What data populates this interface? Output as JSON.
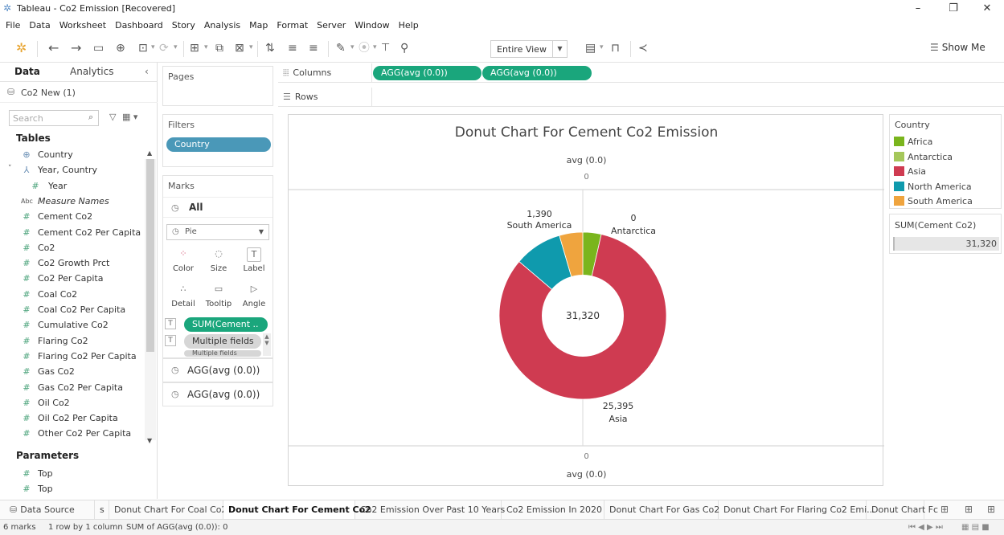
{
  "window": {
    "title": "Tableau - Co2 Emission [Recovered]",
    "minimize": "–",
    "maximize": "❐",
    "close": "✕"
  },
  "menu": [
    "File",
    "Data",
    "Worksheet",
    "Dashboard",
    "Story",
    "Analysis",
    "Map",
    "Format",
    "Server",
    "Window",
    "Help"
  ],
  "toolbar": {
    "view_mode": "Entire View",
    "show_me": "Show Me"
  },
  "data_pane": {
    "tabs": [
      "Data",
      "Analytics"
    ],
    "collapse": "‹",
    "source": "Co2 New (1)",
    "search_placeholder": "Search",
    "tables_header": "Tables",
    "fields": [
      {
        "icon": "globe-icon",
        "glyph": "⊕",
        "label": "Country",
        "child": false,
        "expand": ""
      },
      {
        "icon": "hierarchy-icon",
        "glyph": "⅄",
        "label": "Year, Country",
        "child": false,
        "expand": "˅"
      },
      {
        "icon": "measure-icon",
        "glyph": "#",
        "label": "Year",
        "child": true,
        "expand": ""
      },
      {
        "icon": "abc-icon",
        "glyph": "Abc",
        "label": "Measure Names",
        "child": false,
        "expand": ""
      },
      {
        "icon": "measure-icon",
        "glyph": "#",
        "label": "Cement Co2",
        "child": false,
        "expand": ""
      },
      {
        "icon": "measure-icon",
        "glyph": "#",
        "label": "Cement Co2 Per Capita",
        "child": false,
        "expand": ""
      },
      {
        "icon": "measure-icon",
        "glyph": "#",
        "label": "Co2",
        "child": false,
        "expand": ""
      },
      {
        "icon": "measure-icon",
        "glyph": "#",
        "label": "Co2 Growth Prct",
        "child": false,
        "expand": ""
      },
      {
        "icon": "measure-icon",
        "glyph": "#",
        "label": "Co2 Per Capita",
        "child": false,
        "expand": ""
      },
      {
        "icon": "measure-icon",
        "glyph": "#",
        "label": "Coal Co2",
        "child": false,
        "expand": ""
      },
      {
        "icon": "measure-icon",
        "glyph": "#",
        "label": "Coal Co2 Per Capita",
        "child": false,
        "expand": ""
      },
      {
        "icon": "measure-icon",
        "glyph": "#",
        "label": "Cumulative Co2",
        "child": false,
        "expand": ""
      },
      {
        "icon": "measure-icon",
        "glyph": "#",
        "label": "Flaring Co2",
        "child": false,
        "expand": ""
      },
      {
        "icon": "measure-icon",
        "glyph": "#",
        "label": "Flaring Co2 Per Capita",
        "child": false,
        "expand": ""
      },
      {
        "icon": "measure-icon",
        "glyph": "#",
        "label": "Gas Co2",
        "child": false,
        "expand": ""
      },
      {
        "icon": "measure-icon",
        "glyph": "#",
        "label": "Gas Co2 Per Capita",
        "child": false,
        "expand": ""
      },
      {
        "icon": "measure-icon",
        "glyph": "#",
        "label": "Oil Co2",
        "child": false,
        "expand": ""
      },
      {
        "icon": "measure-icon",
        "glyph": "#",
        "label": "Oil Co2 Per Capita",
        "child": false,
        "expand": ""
      },
      {
        "icon": "measure-icon",
        "glyph": "#",
        "label": "Other Co2 Per Capita",
        "child": false,
        "expand": ""
      }
    ],
    "parameters_header": "Parameters",
    "parameters": [
      "Top",
      "Top"
    ]
  },
  "pages_label": "Pages",
  "filters": {
    "label": "Filters",
    "pill": "Country"
  },
  "marks": {
    "label": "Marks",
    "all": "All",
    "type": "Pie",
    "buttons": [
      {
        "name": "color",
        "glyph": "⁘",
        "label": "Color"
      },
      {
        "name": "size",
        "glyph": "◌",
        "label": "Size"
      },
      {
        "name": "label",
        "glyph": "T",
        "label": "Label"
      },
      {
        "name": "detail",
        "glyph": "∴",
        "label": "Detail"
      },
      {
        "name": "tooltip",
        "glyph": "▭",
        "label": "Tooltip"
      },
      {
        "name": "angle",
        "glyph": "▷",
        "label": "Angle"
      }
    ],
    "pill_sum": "SUM(Cement ..",
    "pill_multiple": "Multiple fields",
    "pill_multiple_partial": "Multiple fields",
    "measures": [
      "AGG(avg (0.0))",
      "AGG(avg (0.0))"
    ]
  },
  "shelves": {
    "columns_label": "Columns",
    "columns_pills": [
      "AGG(avg (0.0))",
      "AGG(avg (0.0))"
    ],
    "rows_label": "Rows"
  },
  "chart_data": {
    "type": "pie",
    "title": "Donut Chart For Cement Co2 Emission",
    "measure": "SUM(Cement Co2)",
    "total": 31320,
    "total_label": "31,320",
    "top_axis_label": "avg (0.0)",
    "top_axis_tick": "0",
    "bottom_axis_tick": "0",
    "bottom_axis_label": "avg (0.0)",
    "slices": [
      {
        "name": "Africa",
        "value": 1095,
        "color": "#7ab51d",
        "label_value": "",
        "label_name": ""
      },
      {
        "name": "Asia",
        "value": 25395,
        "color": "#cf3b51",
        "label_value": "25,395",
        "label_name": "Asia"
      },
      {
        "name": "North America",
        "value": 2840,
        "color": "#0f9aad",
        "label_value": "",
        "label_name": ""
      },
      {
        "name": "South America",
        "value": 1390,
        "color": "#efa43e",
        "label_value": "1,390",
        "label_name": "South America"
      },
      {
        "name": "Antarctica",
        "value": 0,
        "color": "#a5c75b",
        "label_value": "0",
        "label_name": "Antarctica"
      }
    ]
  },
  "legend": {
    "title": "Country",
    "items": [
      {
        "name": "Africa",
        "color": "#7ab51d"
      },
      {
        "name": "Antarctica",
        "color": "#a5c75b"
      },
      {
        "name": "Asia",
        "color": "#cf3b51"
      },
      {
        "name": "North America",
        "color": "#0f9aad"
      },
      {
        "name": "South America",
        "color": "#efa43e"
      }
    ]
  },
  "sum_card": {
    "title": "SUM(Cement Co2)",
    "value": "31,320"
  },
  "sheet_tabs": {
    "data_source": "Data Source",
    "tabs": [
      {
        "label": "s",
        "active": false
      },
      {
        "label": "Donut Chart For Coal Co2",
        "active": false
      },
      {
        "label": "Donut Chart For Cement Co2",
        "active": true
      },
      {
        "label": "Co2 Emission Over Past 10 Years",
        "active": false
      },
      {
        "label": "Co2 Emission In 2020",
        "active": false
      },
      {
        "label": "Donut Chart For Gas Co2",
        "active": false
      },
      {
        "label": "Donut Chart For Flaring Co2 Emi...",
        "active": false
      },
      {
        "label": "Donut Chart Fc",
        "active": false
      }
    ]
  },
  "status": {
    "marks": "6 marks",
    "rows": "1 row by 1 column",
    "sum": "SUM of AGG(avg (0.0)): 0"
  }
}
